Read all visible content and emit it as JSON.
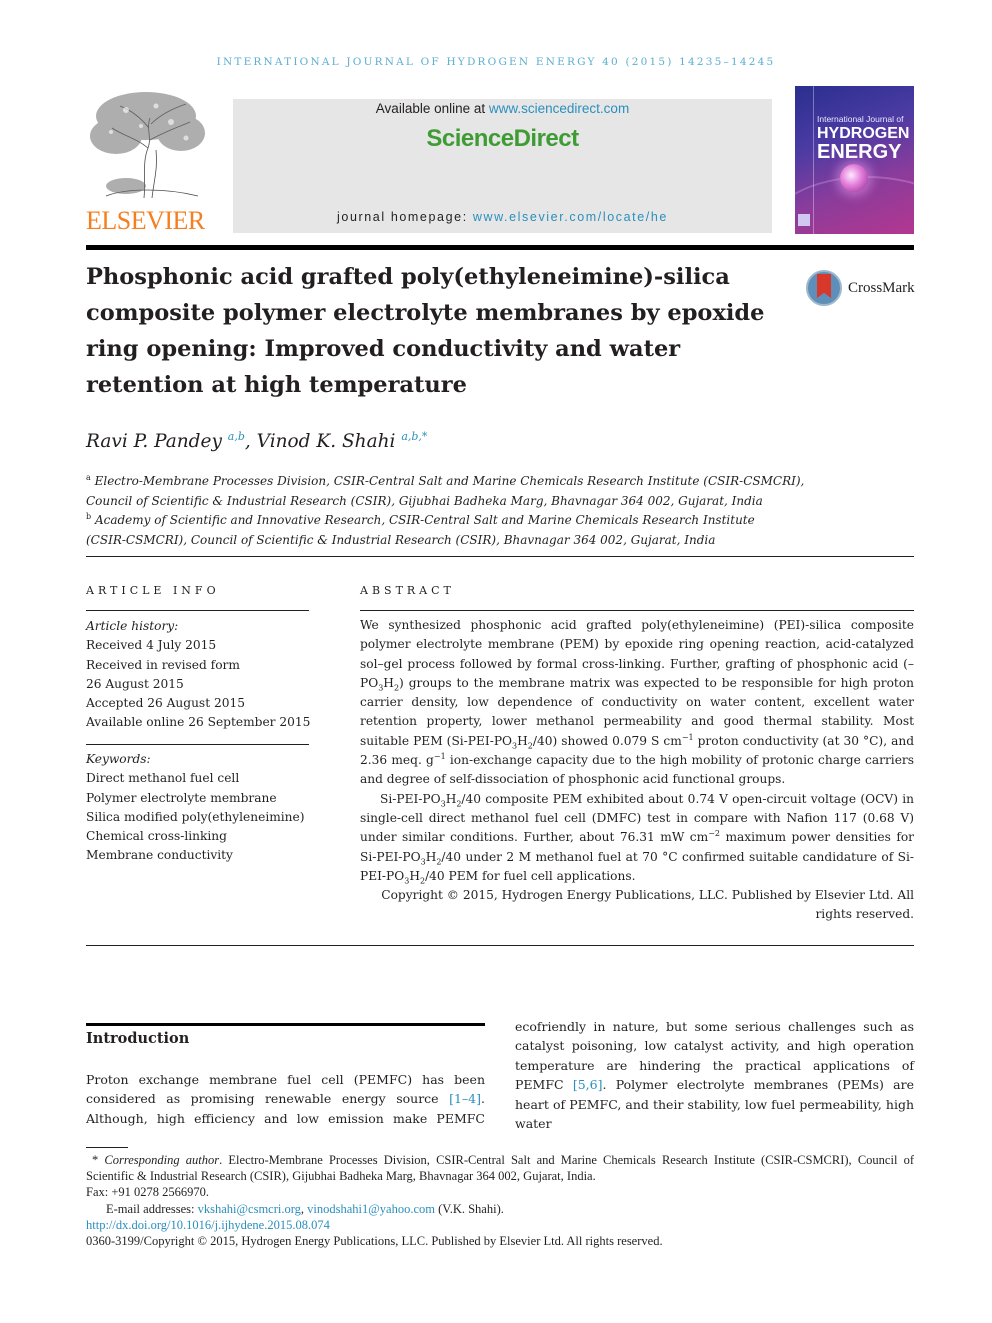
{
  "running_head": "INTERNATIONAL JOURNAL OF HYDROGEN ENERGY 40 (2015) 14235–14245",
  "publisher": {
    "logo_icon": "elsevier-tree-icon",
    "name": "ELSEVIER",
    "name_color": "#f47f20"
  },
  "sciencedirect": {
    "available_prefix": "Available online at ",
    "available_link": "www.sciencedirect.com",
    "brand": "ScienceDirect",
    "brand_color": "#3f9c35",
    "homepage_prefix": "journal homepage: ",
    "homepage_link": "www.elsevier.com/locate/he"
  },
  "journal_cover": {
    "line1": "International Journal of",
    "line2": "HYDROGEN",
    "line3": "ENERGY"
  },
  "crossmark": {
    "icon": "crossmark-icon",
    "label": "CrossMark"
  },
  "title": "Phosphonic acid grafted poly(ethyleneimine)-silica composite polymer electrolyte membranes by epoxide ring opening: Improved conductivity and water retention at high temperature",
  "authors": [
    {
      "name": "Ravi P. Pandey",
      "affil": "a,b"
    },
    {
      "name": "Vinod K. Shahi",
      "affil": "a,b,*"
    }
  ],
  "affiliations": [
    {
      "mark": "a",
      "line1": "Electro-Membrane Processes Division, CSIR-Central Salt and Marine Chemicals Research Institute (CSIR-CSMCRI),",
      "line2": "Council of Scientific & Industrial Research (CSIR), Gijubhai Badheka Marg, Bhavnagar 364 002, Gujarat, India"
    },
    {
      "mark": "b",
      "line1": "Academy of Scientific and Innovative Research, CSIR-Central Salt and Marine Chemicals Research Institute",
      "line2": "(CSIR-CSMCRI), Council of Scientific & Industrial Research (CSIR), Bhavnagar 364 002, Gujarat, India"
    }
  ],
  "article_info": {
    "label": "ARTICLE INFO",
    "history_label": "Article history:",
    "history": [
      "Received 4 July 2015",
      "Received in revised form",
      "26 August 2015",
      "Accepted 26 August 2015",
      "Available online 26 September 2015"
    ],
    "keywords_label": "Keywords:",
    "keywords": [
      "Direct methanol fuel cell",
      "Polymer electrolyte membrane",
      "Silica modified poly(ethyleneimine)",
      "Chemical cross-linking",
      "Membrane conductivity"
    ]
  },
  "abstract": {
    "label": "ABSTRACT",
    "p1_a": "We synthesized phosphonic acid grafted poly(ethyleneimine) (PEI)-silica composite polymer electrolyte membrane (PEM) by epoxide ring opening reaction, acid-catalyzed sol–gel process followed by formal cross-linking. Further, grafting of phosphonic acid (–PO",
    "p1_b": "H",
    "p1_c": ") groups to the membrane matrix was expected to be responsible for high proton carrier density, low dependence of conductivity on water content, excellent water retention property, lower methanol permeability and good thermal stability. Most suitable PEM (Si-PEI-PO",
    "p1_d": "H",
    "p1_e": "/40) showed 0.079 S cm",
    "p1_f": " proton conductivity (at 30 °C), and 2.36 meq. g",
    "p1_g": " ion-exchange capacity due to the high mobility of protonic charge carriers and degree of self-dissociation of phosphonic acid functional groups.",
    "p2_a": "Si-PEI-PO",
    "p2_b": "H",
    "p2_c": "/40 composite PEM exhibited about 0.74 V open-circuit voltage (OCV) in single-cell direct methanol fuel cell (DMFC) test in compare with Nafion 117 (0.68 V) under similar conditions. Further, about 76.31 mW cm",
    "p2_d": " maximum power densities for Si-PEI-PO",
    "p2_e": "H",
    "p2_f": "/40 under 2 M methanol fuel at 70 °C confirmed suitable candidature of Si-PEI-PO",
    "p2_g": "H",
    "p2_h": "/40 PEM for fuel cell applications.",
    "sub3": "3",
    "sub2": "2",
    "sup_m1": "−1",
    "sup_m2": "−2",
    "copyright": "Copyright © 2015, Hydrogen Energy Publications, LLC. Published by Elsevier Ltd. All rights reserved."
  },
  "introduction": {
    "heading": "Introduction",
    "left_a": "Proton exchange membrane fuel cell (PEMFC) has been considered as promising renewable energy source ",
    "left_ref": "[1–4]",
    "left_b": ". Although, high efficiency and low emission make PEMFC",
    "right_a": "ecofriendly in nature, but some serious challenges such as catalyst poisoning, low catalyst activity, and high operation temperature are hindering the practical applications of PEMFC ",
    "right_ref": "[5,6]",
    "right_b": ". Polymer electrolyte membranes (PEMs) are heart of PEMFC, and their stability, low fuel permeability, high water"
  },
  "footnotes": {
    "corr_mark": "*",
    "corr_label": "Corresponding author",
    "corr_text": ". Electro-Membrane Processes Division, CSIR-Central Salt and Marine Chemicals Research Institute (CSIR-CSMCRI), Council of Scientific & Industrial Research (CSIR), Gijubhai Badheka Marg, Bhavnagar 364 002, Gujarat, India.",
    "fax": "Fax: +91 0278 2566970.",
    "email_prefix": "E-mail addresses: ",
    "email1": "vkshahi@csmcri.org",
    "email_sep": ", ",
    "email2": "vinodshahi1@yahoo.com",
    "email_suffix": " (V.K. Shahi).",
    "doi": "http://dx.doi.org/10.1016/j.ijhydene.2015.08.074",
    "copyright": "0360-3199/Copyright © 2015, Hydrogen Energy Publications, LLC. Published by Elsevier Ltd. All rights reserved."
  }
}
